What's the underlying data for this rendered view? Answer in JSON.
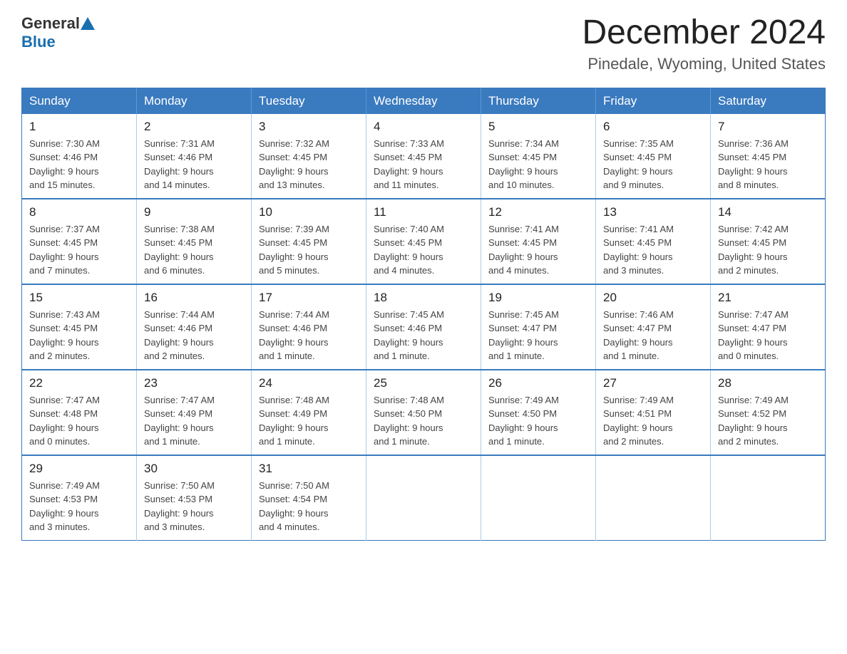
{
  "header": {
    "logo_general": "General",
    "logo_blue": "Blue",
    "title": "December 2024",
    "subtitle": "Pinedale, Wyoming, United States"
  },
  "days_of_week": [
    "Sunday",
    "Monday",
    "Tuesday",
    "Wednesday",
    "Thursday",
    "Friday",
    "Saturday"
  ],
  "weeks": [
    [
      {
        "day": "1",
        "sunrise": "7:30 AM",
        "sunset": "4:46 PM",
        "daylight": "9 hours and 15 minutes."
      },
      {
        "day": "2",
        "sunrise": "7:31 AM",
        "sunset": "4:46 PM",
        "daylight": "9 hours and 14 minutes."
      },
      {
        "day": "3",
        "sunrise": "7:32 AM",
        "sunset": "4:45 PM",
        "daylight": "9 hours and 13 minutes."
      },
      {
        "day": "4",
        "sunrise": "7:33 AM",
        "sunset": "4:45 PM",
        "daylight": "9 hours and 11 minutes."
      },
      {
        "day": "5",
        "sunrise": "7:34 AM",
        "sunset": "4:45 PM",
        "daylight": "9 hours and 10 minutes."
      },
      {
        "day": "6",
        "sunrise": "7:35 AM",
        "sunset": "4:45 PM",
        "daylight": "9 hours and 9 minutes."
      },
      {
        "day": "7",
        "sunrise": "7:36 AM",
        "sunset": "4:45 PM",
        "daylight": "9 hours and 8 minutes."
      }
    ],
    [
      {
        "day": "8",
        "sunrise": "7:37 AM",
        "sunset": "4:45 PM",
        "daylight": "9 hours and 7 minutes."
      },
      {
        "day": "9",
        "sunrise": "7:38 AM",
        "sunset": "4:45 PM",
        "daylight": "9 hours and 6 minutes."
      },
      {
        "day": "10",
        "sunrise": "7:39 AM",
        "sunset": "4:45 PM",
        "daylight": "9 hours and 5 minutes."
      },
      {
        "day": "11",
        "sunrise": "7:40 AM",
        "sunset": "4:45 PM",
        "daylight": "9 hours and 4 minutes."
      },
      {
        "day": "12",
        "sunrise": "7:41 AM",
        "sunset": "4:45 PM",
        "daylight": "9 hours and 4 minutes."
      },
      {
        "day": "13",
        "sunrise": "7:41 AM",
        "sunset": "4:45 PM",
        "daylight": "9 hours and 3 minutes."
      },
      {
        "day": "14",
        "sunrise": "7:42 AM",
        "sunset": "4:45 PM",
        "daylight": "9 hours and 2 minutes."
      }
    ],
    [
      {
        "day": "15",
        "sunrise": "7:43 AM",
        "sunset": "4:45 PM",
        "daylight": "9 hours and 2 minutes."
      },
      {
        "day": "16",
        "sunrise": "7:44 AM",
        "sunset": "4:46 PM",
        "daylight": "9 hours and 2 minutes."
      },
      {
        "day": "17",
        "sunrise": "7:44 AM",
        "sunset": "4:46 PM",
        "daylight": "9 hours and 1 minute."
      },
      {
        "day": "18",
        "sunrise": "7:45 AM",
        "sunset": "4:46 PM",
        "daylight": "9 hours and 1 minute."
      },
      {
        "day": "19",
        "sunrise": "7:45 AM",
        "sunset": "4:47 PM",
        "daylight": "9 hours and 1 minute."
      },
      {
        "day": "20",
        "sunrise": "7:46 AM",
        "sunset": "4:47 PM",
        "daylight": "9 hours and 1 minute."
      },
      {
        "day": "21",
        "sunrise": "7:47 AM",
        "sunset": "4:47 PM",
        "daylight": "9 hours and 0 minutes."
      }
    ],
    [
      {
        "day": "22",
        "sunrise": "7:47 AM",
        "sunset": "4:48 PM",
        "daylight": "9 hours and 0 minutes."
      },
      {
        "day": "23",
        "sunrise": "7:47 AM",
        "sunset": "4:49 PM",
        "daylight": "9 hours and 1 minute."
      },
      {
        "day": "24",
        "sunrise": "7:48 AM",
        "sunset": "4:49 PM",
        "daylight": "9 hours and 1 minute."
      },
      {
        "day": "25",
        "sunrise": "7:48 AM",
        "sunset": "4:50 PM",
        "daylight": "9 hours and 1 minute."
      },
      {
        "day": "26",
        "sunrise": "7:49 AM",
        "sunset": "4:50 PM",
        "daylight": "9 hours and 1 minute."
      },
      {
        "day": "27",
        "sunrise": "7:49 AM",
        "sunset": "4:51 PM",
        "daylight": "9 hours and 2 minutes."
      },
      {
        "day": "28",
        "sunrise": "7:49 AM",
        "sunset": "4:52 PM",
        "daylight": "9 hours and 2 minutes."
      }
    ],
    [
      {
        "day": "29",
        "sunrise": "7:49 AM",
        "sunset": "4:53 PM",
        "daylight": "9 hours and 3 minutes."
      },
      {
        "day": "30",
        "sunrise": "7:50 AM",
        "sunset": "4:53 PM",
        "daylight": "9 hours and 3 minutes."
      },
      {
        "day": "31",
        "sunrise": "7:50 AM",
        "sunset": "4:54 PM",
        "daylight": "9 hours and 4 minutes."
      },
      null,
      null,
      null,
      null
    ]
  ],
  "labels": {
    "sunrise": "Sunrise:",
    "sunset": "Sunset:",
    "daylight": "Daylight:"
  }
}
